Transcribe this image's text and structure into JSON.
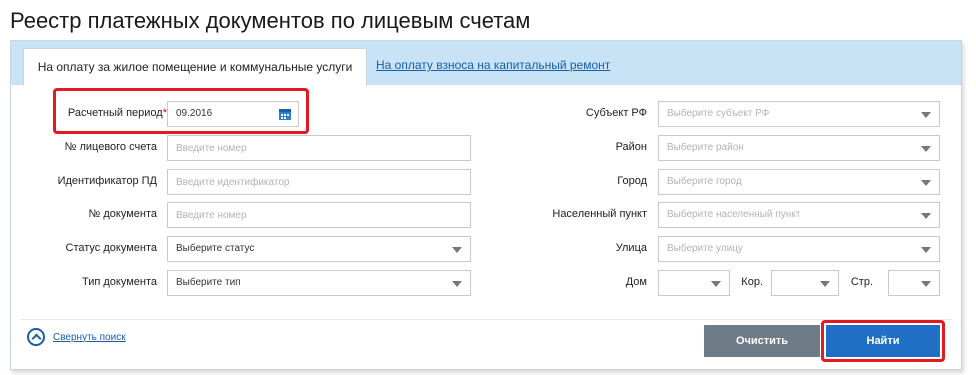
{
  "title": "Реестр платежных документов по лицевым счетам",
  "tabs": [
    {
      "label": "На оплату за жилое помещение и коммунальные услуги"
    },
    {
      "label": "На оплату взноса на капитальный ремонт"
    }
  ],
  "left_fields": {
    "period": {
      "label": "Расчетный период",
      "required_mark": "*",
      "value": "09.2016"
    },
    "account": {
      "label": "№ лицевого счета",
      "placeholder": "Введите номер"
    },
    "pd_id": {
      "label": "Идентификатор ПД",
      "placeholder": "Введите идентификатор"
    },
    "doc_num": {
      "label": "№ документа",
      "placeholder": "Введите номер"
    },
    "doc_status": {
      "label": "Статус документа",
      "value": "Выберите статус"
    },
    "doc_type": {
      "label": "Тип документа",
      "value": "Выберите тип"
    }
  },
  "right_fields": {
    "subject": {
      "label": "Субъект РФ",
      "placeholder": "Выберите субъект РФ"
    },
    "district": {
      "label": "Район",
      "placeholder": "Выберите район"
    },
    "city": {
      "label": "Город",
      "placeholder": "Выберите город"
    },
    "locality": {
      "label": "Населенный пункт",
      "placeholder": "Выберите населенный пункт"
    },
    "street": {
      "label": "Улица",
      "placeholder": "Выберите улицу"
    },
    "house": {
      "label": "Дом"
    },
    "corp": {
      "label": "Кор."
    },
    "building": {
      "label": "Стр."
    }
  },
  "collapse_label": "Свернуть поиск",
  "buttons": {
    "clear": "Очистить",
    "find": "Найти"
  },
  "colors": {
    "accent": "#1f6fc4",
    "tab_bar": "#c7e3f5",
    "highlight": "#e01b24"
  }
}
